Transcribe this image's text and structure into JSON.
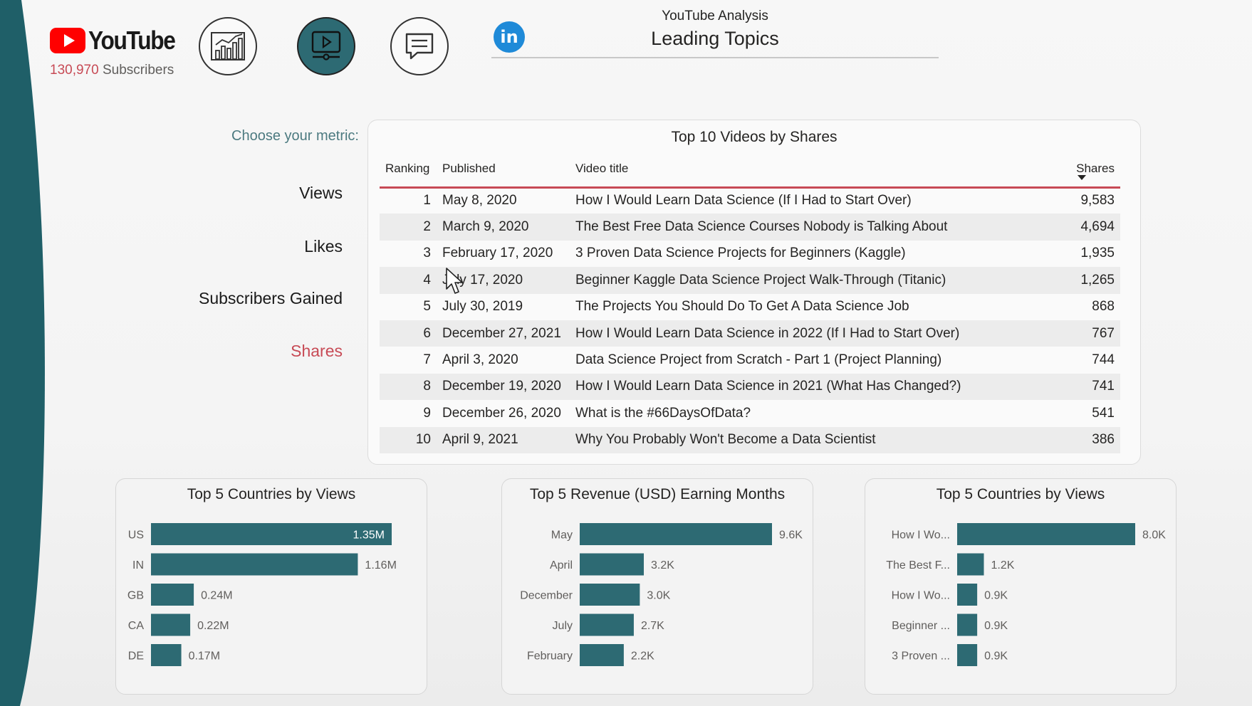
{
  "header": {
    "brand": "YouTube",
    "subscriber_count": "130,970",
    "subscriber_suffix": " Subscribers",
    "app_title": "YouTube Analysis",
    "page_title": "Leading Topics",
    "linkedin_glyph": "in"
  },
  "nav": {
    "icons": [
      "analytics-chart-icon",
      "video-play-icon",
      "comments-icon",
      "linkedin-icon"
    ],
    "active": "video-play-icon"
  },
  "metrics": {
    "label": "Choose your metric:",
    "options": [
      "Views",
      "Likes",
      "Subscribers Gained",
      "Shares"
    ],
    "selected": "Shares"
  },
  "table": {
    "title": "Top 10 Videos by Shares",
    "columns": [
      "Ranking",
      "Published",
      "Video title",
      "Shares"
    ],
    "rows": [
      {
        "rank": "1",
        "published": "May 8, 2020",
        "title": "How I Would Learn Data Science (If I Had to Start Over)",
        "shares": "9,583"
      },
      {
        "rank": "2",
        "published": "March 9, 2020",
        "title": "The Best Free Data Science Courses Nobody is Talking About",
        "shares": "4,694"
      },
      {
        "rank": "3",
        "published": "February 17, 2020",
        "title": "3 Proven Data Science Projects for Beginners (Kaggle)",
        "shares": "1,935"
      },
      {
        "rank": "4",
        "published": "July 17, 2020",
        "title": "Beginner Kaggle Data Science Project Walk-Through (Titanic)",
        "shares": "1,265"
      },
      {
        "rank": "5",
        "published": "July 30, 2019",
        "title": "The Projects You Should Do To Get A Data Science Job",
        "shares": "868"
      },
      {
        "rank": "6",
        "published": "December 27, 2021",
        "title": "How I Would Learn Data Science in 2022 (If I Had to Start Over)",
        "shares": "767"
      },
      {
        "rank": "7",
        "published": "April 3, 2020",
        "title": "Data Science Project from Scratch - Part 1 (Project Planning)",
        "shares": "744"
      },
      {
        "rank": "8",
        "published": "December 19, 2020",
        "title": "How I Would Learn Data Science in 2021 (What Has Changed?)",
        "shares": "741"
      },
      {
        "rank": "9",
        "published": "December 26, 2020",
        "title": "What is the #66DaysOfData?",
        "shares": "541"
      },
      {
        "rank": "10",
        "published": "April 9, 2021",
        "title": "Why You Probably Won't Become a Data Scientist",
        "shares": "386"
      }
    ]
  },
  "colors": {
    "accent_red": "#c74a55",
    "bar_teal": "#2d6a73",
    "linkedin_blue": "#1f8ad8",
    "youtube_red": "#ff0000"
  },
  "chart_data": [
    {
      "type": "bar",
      "orientation": "horizontal",
      "title": "Top 5 Countries by Views",
      "categories": [
        "US",
        "IN",
        "GB",
        "CA",
        "DE"
      ],
      "values": [
        1350000,
        1160000,
        240000,
        220000,
        170000
      ],
      "labels": [
        "1.35M",
        "1.16M",
        "0.24M",
        "0.22M",
        "0.17M"
      ],
      "label_inside_first": true,
      "xlim": [
        0,
        1350000
      ],
      "color": "#2d6a73"
    },
    {
      "type": "bar",
      "orientation": "horizontal",
      "title": "Top 5 Revenue (USD) Earning Months",
      "categories": [
        "May",
        "April",
        "December",
        "July",
        "February"
      ],
      "values": [
        9600,
        3200,
        3000,
        2700,
        2200
      ],
      "labels": [
        "9.6K",
        "3.2K",
        "3.0K",
        "2.7K",
        "2.2K"
      ],
      "label_inside_first": false,
      "xlim": [
        0,
        9600
      ],
      "color": "#2d6a73"
    },
    {
      "type": "bar",
      "orientation": "horizontal",
      "title": "Top 5 Countries by Views",
      "categories": [
        "How I Wo...",
        "The Best F...",
        "How I Wo...",
        "Beginner ...",
        "3 Proven ..."
      ],
      "values": [
        8000,
        1200,
        900,
        900,
        900
      ],
      "labels": [
        "8.0K",
        "1.2K",
        "0.9K",
        "0.9K",
        "0.9K"
      ],
      "label_inside_first": false,
      "xlim": [
        0,
        8000
      ],
      "color": "#2d6a73"
    }
  ]
}
